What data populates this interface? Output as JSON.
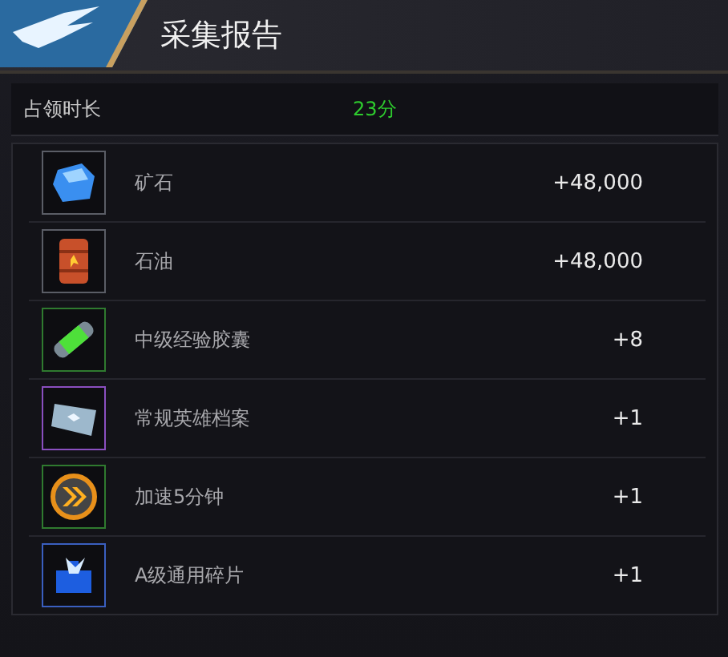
{
  "header": {
    "title": "采集报告"
  },
  "summary": {
    "label": "占领时长",
    "value": "23分"
  },
  "items": [
    {
      "kind": "ore",
      "name": "矿石",
      "amount": "+48,000",
      "color": "#5a5d66"
    },
    {
      "kind": "oil",
      "name": "石油",
      "amount": "+48,000",
      "color": "#5a5d66"
    },
    {
      "kind": "capsule",
      "name": "中级经验胶囊",
      "amount": "+8",
      "color": "#2f7a2f"
    },
    {
      "kind": "file",
      "name": "常规英雄档案",
      "amount": "+1",
      "color": "#8a4fc0"
    },
    {
      "kind": "speed",
      "name": "加速5分钟",
      "amount": "+1",
      "color": "#2f7a2f"
    },
    {
      "kind": "shard",
      "name": "A级通用碎片",
      "amount": "+1",
      "color": "#3a5fc0"
    }
  ]
}
